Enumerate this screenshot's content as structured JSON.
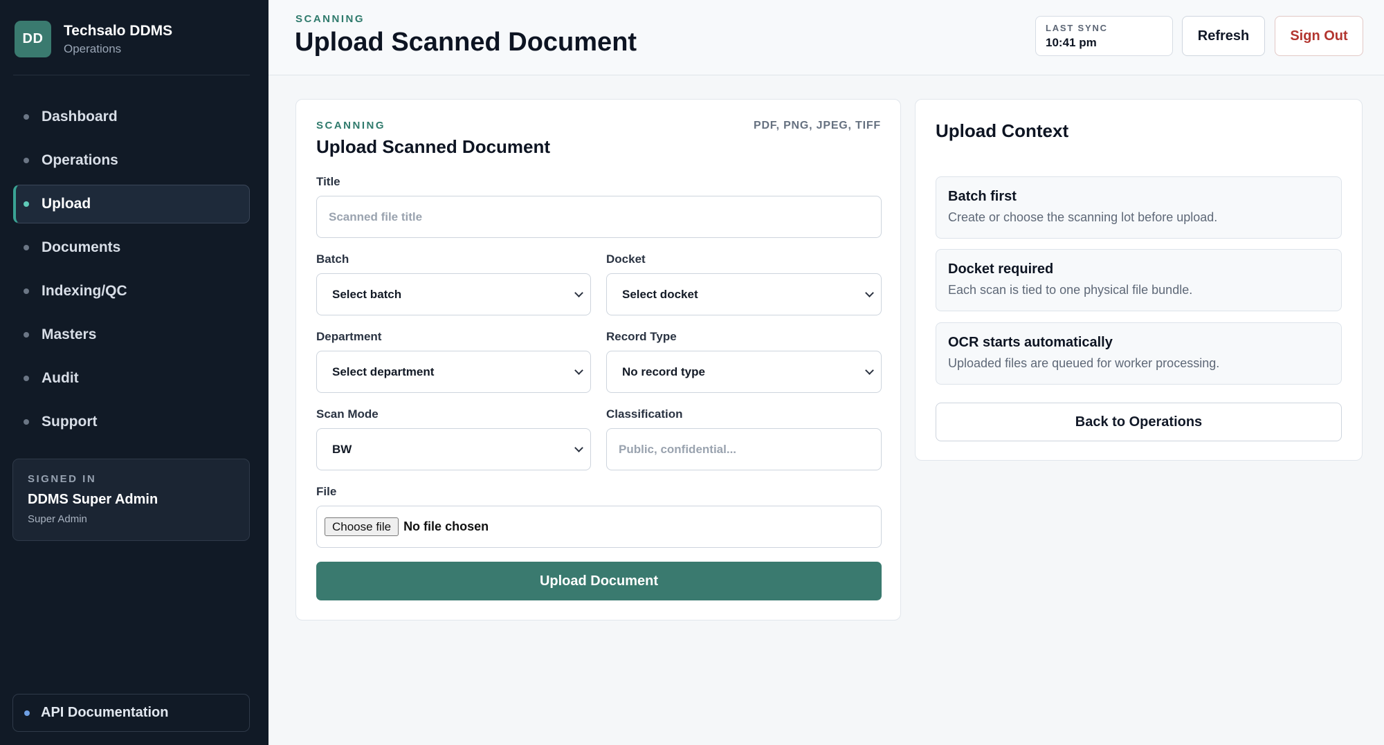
{
  "brand": {
    "initials": "DD",
    "name": "Techsalo DDMS",
    "subtitle": "Operations"
  },
  "sidebar": {
    "items": [
      {
        "label": "Dashboard",
        "active": false
      },
      {
        "label": "Operations",
        "active": false
      },
      {
        "label": "Upload",
        "active": true
      },
      {
        "label": "Documents",
        "active": false
      },
      {
        "label": "Indexing/QC",
        "active": false
      },
      {
        "label": "Masters",
        "active": false
      },
      {
        "label": "Audit",
        "active": false
      },
      {
        "label": "Support",
        "active": false
      }
    ],
    "signed_in": {
      "label": "SIGNED IN",
      "name": "DDMS Super Admin",
      "role": "Super Admin"
    },
    "api_link": "API Documentation"
  },
  "header": {
    "eyebrow": "SCANNING",
    "title": "Upload Scanned Document",
    "sync_label": "LAST SYNC",
    "sync_value": "10:41 pm",
    "refresh_label": "Refresh",
    "signout_label": "Sign Out"
  },
  "form": {
    "eyebrow": "SCANNING",
    "file_types": "PDF, PNG, JPEG, TIFF",
    "title": "Upload Scanned Document",
    "title_label": "Title",
    "title_placeholder": "Scanned file title",
    "batch_label": "Batch",
    "batch_value": "Select batch",
    "docket_label": "Docket",
    "docket_value": "Select docket",
    "department_label": "Department",
    "department_value": "Select department",
    "record_type_label": "Record Type",
    "record_type_value": "No record type",
    "scan_mode_label": "Scan Mode",
    "scan_mode_value": "BW",
    "classification_label": "Classification",
    "classification_placeholder": "Public, confidential...",
    "file_label": "File",
    "file_button": "Choose file",
    "file_status": "No file chosen",
    "submit_label": "Upload Document"
  },
  "context": {
    "title": "Upload Context",
    "items": [
      {
        "title": "Batch first",
        "desc": "Create or choose the scanning lot before upload."
      },
      {
        "title": "Docket required",
        "desc": "Each scan is tied to one physical file bundle."
      },
      {
        "title": "OCR starts automatically",
        "desc": "Uploaded files are queued for worker processing."
      }
    ],
    "back_label": "Back to Operations"
  },
  "colors": {
    "sidebar_bg": "#111a26",
    "accent": "#3a7a6f",
    "signout": "#b2352f"
  }
}
